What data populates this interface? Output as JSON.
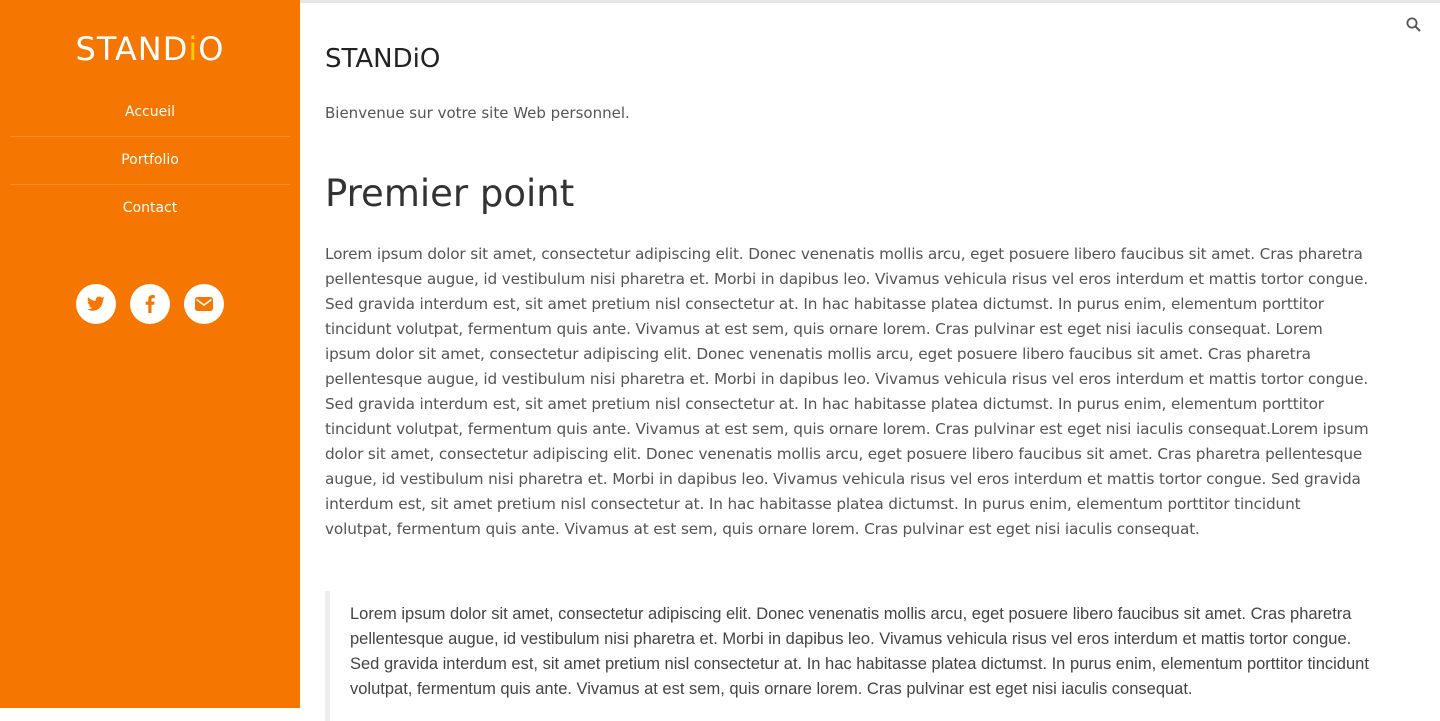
{
  "sidebar": {
    "logo_main": "STAND",
    "logo_accent": "i",
    "logo_end": "O",
    "nav": [
      {
        "label": "Accueil"
      },
      {
        "label": "Portfolio"
      },
      {
        "label": "Contact"
      }
    ],
    "social_icons": [
      "twitter-icon",
      "facebook-icon",
      "mail-icon"
    ],
    "background_color": "#f57600",
    "accent_color": "#ffcc00"
  },
  "header": {
    "search_icon": "search-icon"
  },
  "main": {
    "site_title": "STANDiO",
    "welcome": "Bienvenue sur votre site Web personnel.",
    "heading": "Premier point",
    "paragraph": "Lorem ipsum dolor sit amet, consectetur adipiscing elit. Donec venenatis mollis arcu, eget posuere libero faucibus sit amet. Cras pharetra pellentesque augue, id vestibulum nisi pharetra et. Morbi in dapibus leo. Vivamus vehicula risus vel eros interdum et mattis tortor congue. Sed gravida interdum est, sit amet pretium nisl consectetur at. In hac habitasse platea dictumst. In purus enim, elementum porttitor tincidunt volutpat, fermentum quis ante. Vivamus at est sem, quis ornare lorem. Cras pulvinar est eget nisi iaculis consequat. Lorem ipsum dolor sit amet, consectetur adipiscing elit. Donec venenatis mollis arcu, eget posuere libero faucibus sit amet. Cras pharetra pellentesque augue, id vestibulum nisi pharetra et. Morbi in dapibus leo. Vivamus vehicula risus vel eros interdum et mattis tortor congue. Sed gravida interdum est, sit amet pretium nisl consectetur at. In hac habitasse platea dictumst. In purus enim, elementum porttitor tincidunt volutpat, fermentum quis ante. Vivamus at est sem, quis ornare lorem. Cras pulvinar est eget nisi iaculis consequat.Lorem ipsum dolor sit amet, consectetur adipiscing elit. Donec venenatis mollis arcu, eget posuere libero faucibus sit amet. Cras pharetra pellentesque augue, id vestibulum nisi pharetra et. Morbi in dapibus leo. Vivamus vehicula risus vel eros interdum et mattis tortor congue. Sed gravida interdum est, sit amet pretium nisl consectetur at. In hac habitasse platea dictumst. In purus enim, elementum porttitor tincidunt volutpat, fermentum quis ante. Vivamus at est sem, quis ornare lorem. Cras pulvinar est eget nisi iaculis consequat.",
    "blockquote": "Lorem ipsum dolor sit amet, consectetur adipiscing elit. Donec venenatis mollis arcu, eget posuere libero faucibus sit amet. Cras pharetra pellentesque augue, id vestibulum nisi pharetra et. Morbi in dapibus leo. Vivamus vehicula risus vel eros interdum et mattis tortor congue. Sed gravida interdum est, sit amet pretium nisl consectetur at. In hac habitasse platea dictumst. In purus enim, elementum porttitor tincidunt volutpat, fermentum quis ante. Vivamus at est sem, quis ornare lorem. Cras pulvinar est eget nisi iaculis consequat."
  }
}
